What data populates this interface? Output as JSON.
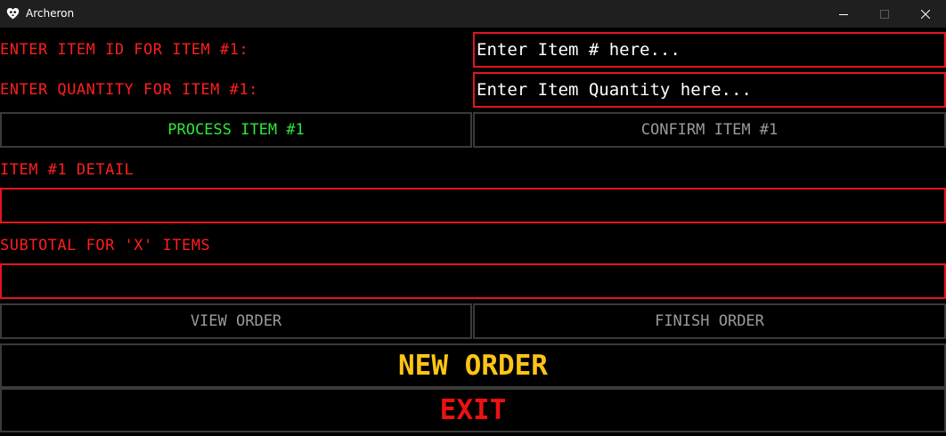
{
  "window": {
    "title": "Archeron",
    "icon": "heart-skull-app-icon"
  },
  "form": {
    "item_id_label": "ENTER ITEM ID FOR ITEM #1:",
    "item_id_placeholder": "Enter Item # here...",
    "quantity_label": "ENTER QUANTITY FOR ITEM #1:",
    "quantity_placeholder": "Enter Item Quantity here...",
    "detail_label": "ITEM #1 DETAIL",
    "detail_value": "",
    "subtotal_label": "SUBTOTAL FOR 'X' ITEMS",
    "subtotal_value": ""
  },
  "buttons": {
    "process": "PROCESS ITEM #1",
    "confirm": "CONFIRM ITEM #1",
    "view_order": "VIEW ORDER",
    "finish_order": "FINISH ORDER",
    "new_order": "NEW ORDER",
    "exit": "EXIT"
  },
  "colors": {
    "label_red": "#ff1e1e",
    "field_border": "#e3141e",
    "process_green": "#2ee63a",
    "disabled_gray": "#9a9a9a",
    "new_order_yellow": "#ffc414",
    "exit_red": "#ee1111",
    "background": "#000000"
  }
}
